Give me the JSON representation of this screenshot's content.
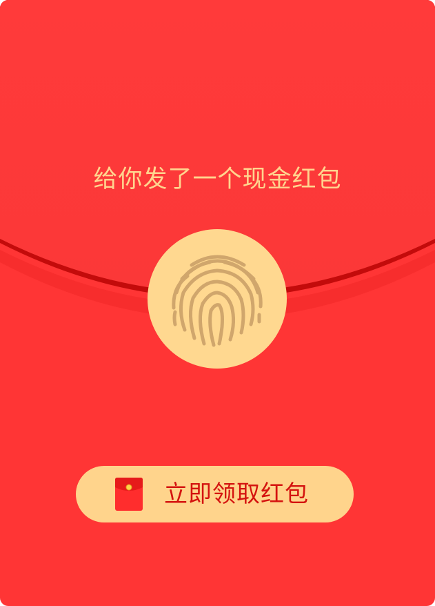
{
  "envelope": {
    "title": "给你发了一个现金红包",
    "open_icon": "fingerprint-icon",
    "claim_button": {
      "label": "立即领取红包",
      "icon": "red-envelope-icon"
    }
  },
  "colors": {
    "envelope_body": "#ff3535",
    "flap": "#fe3b3b",
    "flap_edge": "#c30b0b",
    "accent_gold": "#ffd58f",
    "fingerprint": "#d0a66c",
    "button_text": "#d4130f"
  }
}
